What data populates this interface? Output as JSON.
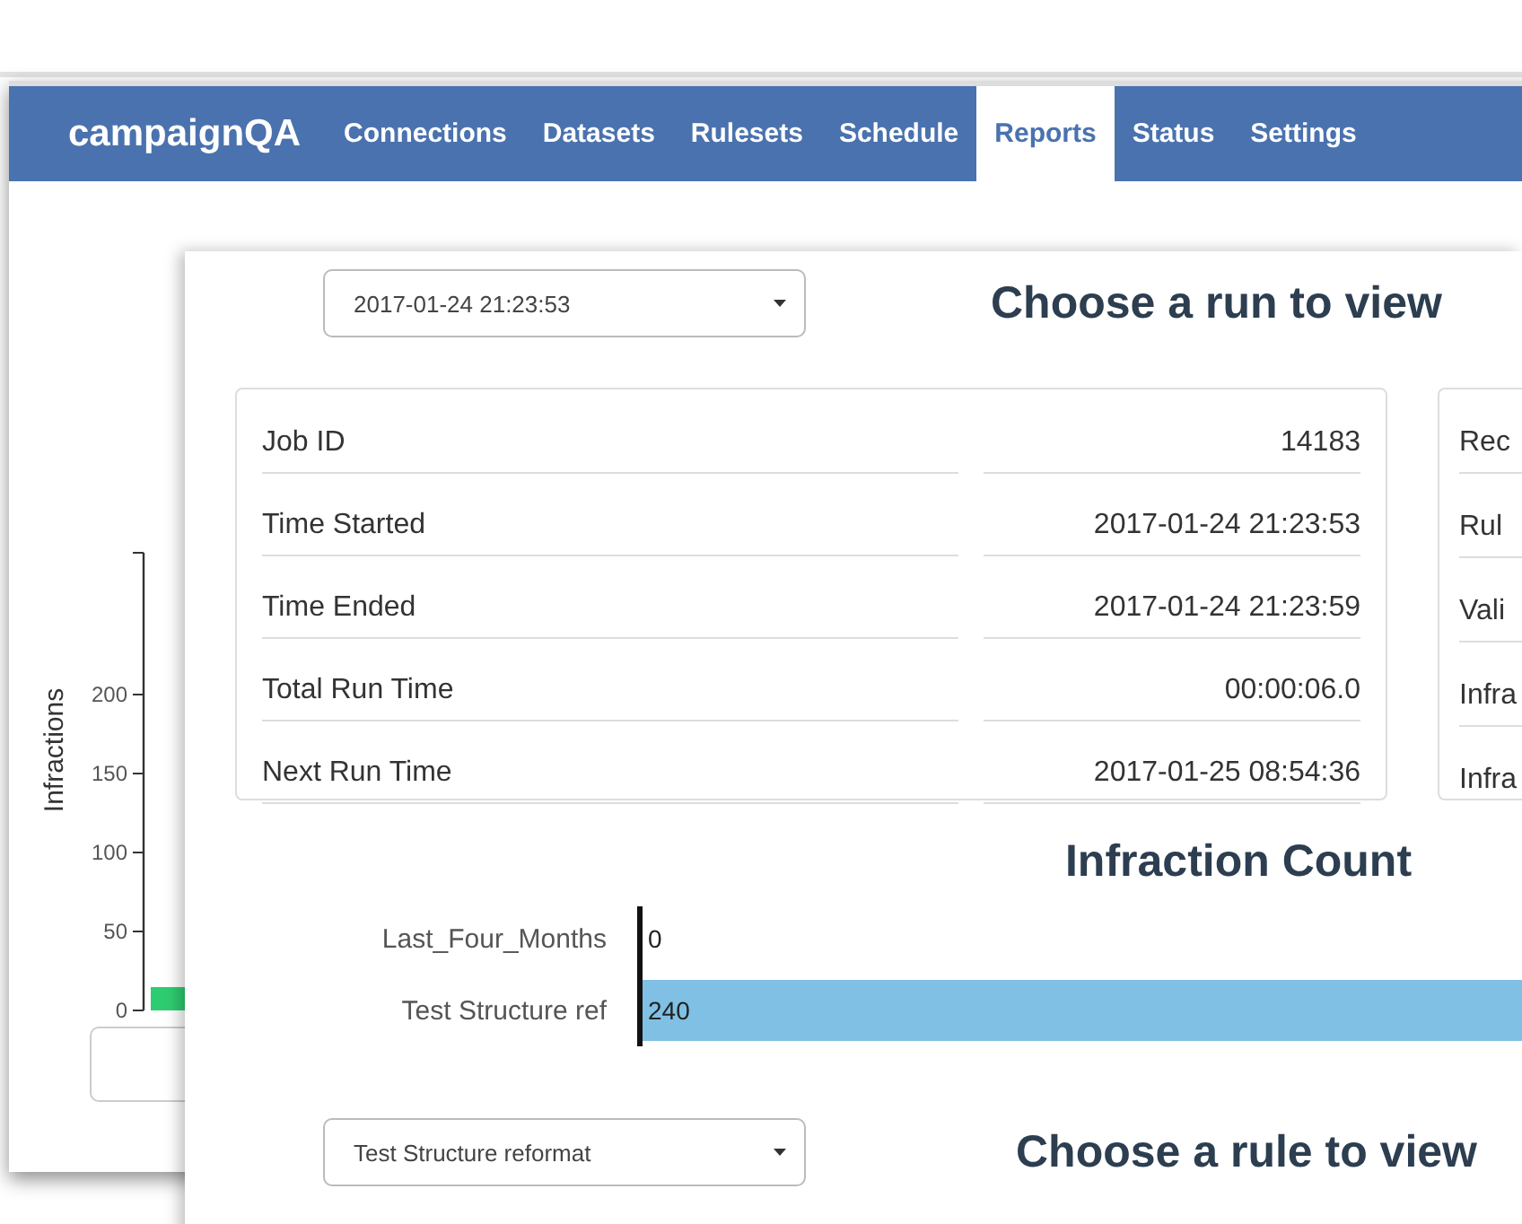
{
  "back_page": {
    "navbar": {
      "brand": "campaignQA",
      "tabs": [
        {
          "label": "Connections",
          "selected": false
        },
        {
          "label": "Datasets",
          "selected": false
        },
        {
          "label": "Rulesets",
          "selected": false
        },
        {
          "label": "Schedule",
          "selected": false
        },
        {
          "label": "Reports",
          "selected": true
        },
        {
          "label": "Status",
          "selected": false
        },
        {
          "label": "Settings",
          "selected": false
        }
      ]
    },
    "chart": {
      "y_axis_label": "Infractions",
      "y_ticks": [
        "200",
        "150",
        "100",
        "50",
        "0"
      ]
    }
  },
  "front_page": {
    "run_select": {
      "value": "2017-01-24 21:23:53"
    },
    "run_heading": "Choose a run to view",
    "job_details": [
      {
        "label": "Job ID",
        "value": "14183"
      },
      {
        "label": "Time Started",
        "value": "2017-01-24 21:23:53"
      },
      {
        "label": "Time Ended",
        "value": "2017-01-24 21:23:59"
      },
      {
        "label": "Total Run Time",
        "value": "00:00:06.0"
      },
      {
        "label": "Next Run Time",
        "value": "2017-01-25 08:54:36"
      }
    ],
    "second_card": [
      "Rec",
      "Rul",
      "Vali",
      "Infra",
      "Infra"
    ],
    "infraction_count": {
      "title": "Infraction Count",
      "rows": [
        {
          "label": "Last_Four_Months",
          "count": "0"
        },
        {
          "label": "Test Structure ref",
          "count": "240"
        }
      ]
    },
    "rule_select": {
      "value": "Test Structure reformat"
    },
    "rule_heading": "Choose a rule to view"
  }
}
